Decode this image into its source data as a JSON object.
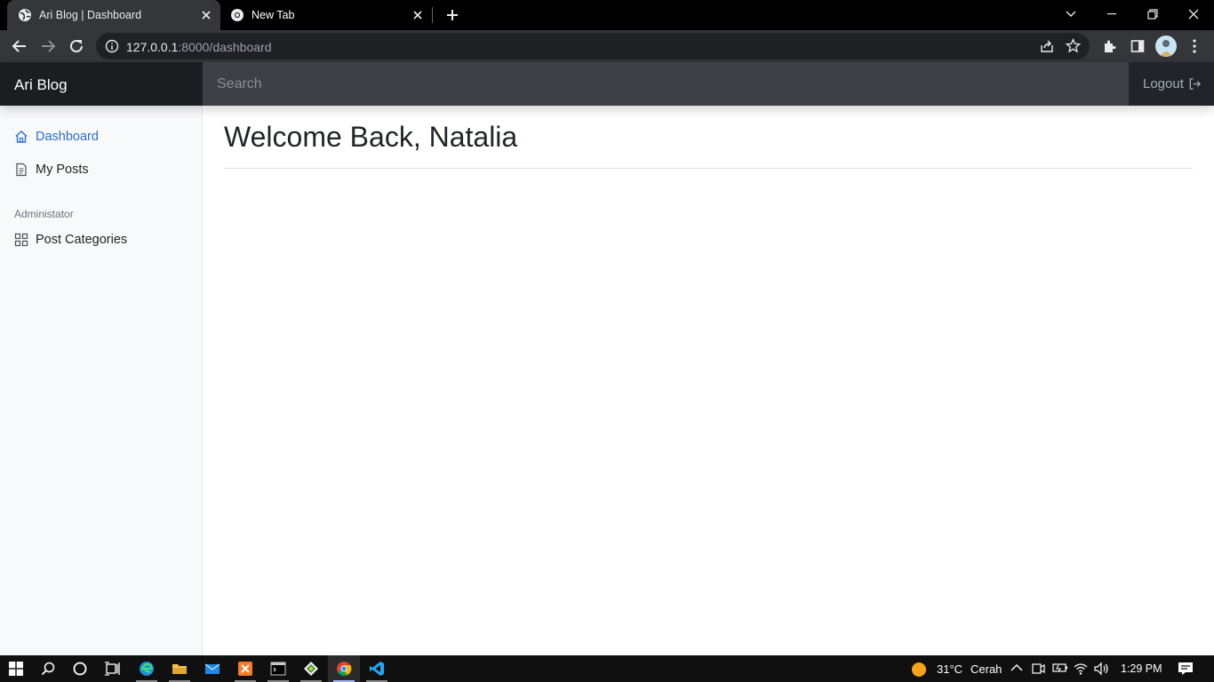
{
  "browser": {
    "tabs": [
      {
        "title": "Ari Blog | Dashboard",
        "active": true
      },
      {
        "title": "New Tab",
        "active": false
      }
    ],
    "url_host": "127.0.0.1",
    "url_path": ":8000/dashboard"
  },
  "navbar": {
    "brand": "Ari Blog",
    "search_placeholder": "Search",
    "logout_label": "Logout"
  },
  "sidebar": {
    "items": [
      {
        "label": "Dashboard",
        "icon": "house-icon",
        "active": true
      },
      {
        "label": "My Posts",
        "icon": "file-text-icon",
        "active": false
      }
    ],
    "admin_heading": "Administator",
    "admin_items": [
      {
        "label": "Post Categories",
        "icon": "grid-icon",
        "active": false
      }
    ]
  },
  "main": {
    "title": "Welcome Back, Natalia"
  },
  "taskbar": {
    "weather_temp": "31°C",
    "weather_text": "Cerah",
    "clock": "1:29 PM"
  },
  "colors": {
    "navbar_bg": "#212529",
    "brand_bg": "#1b1e21",
    "search_bg": "#3d4044",
    "sidebar_bg": "#f8f9fa",
    "link_active": "#2c6dd2"
  }
}
